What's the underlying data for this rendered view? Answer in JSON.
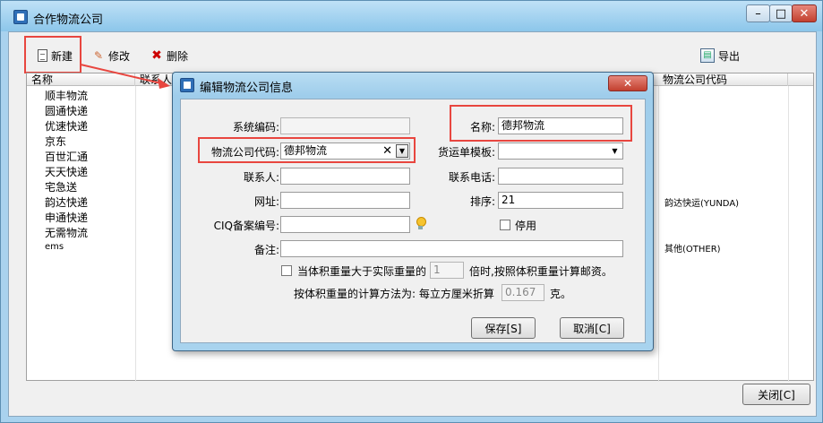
{
  "window": {
    "title": "合作物流公司"
  },
  "toolbar": {
    "new_label": "新建",
    "edit_label": "修改",
    "delete_label": "删除",
    "export_label": "导出"
  },
  "grid": {
    "headers": {
      "name": "名称",
      "contact": "联系人",
      "code": "物流公司代码"
    },
    "rows": [
      {
        "name": "顺丰物流",
        "code": ""
      },
      {
        "name": "圆通快递",
        "code": ""
      },
      {
        "name": "优速快递",
        "code": ""
      },
      {
        "name": "京东",
        "code": ""
      },
      {
        "name": "百世汇通",
        "code": ""
      },
      {
        "name": "天天快递",
        "code": ""
      },
      {
        "name": "宅急送",
        "code": ""
      },
      {
        "name": "韵达快递",
        "code": "韵达快运(YUNDA)"
      },
      {
        "name": "申通快递",
        "code": ""
      },
      {
        "name": "无需物流",
        "code": ""
      },
      {
        "name": "ems",
        "code": "其他(OTHER)"
      }
    ]
  },
  "footer": {
    "close_label": "关闭[C]"
  },
  "dialog": {
    "title": "编辑物流公司信息",
    "labels": {
      "system_code": "系统编码:",
      "name": "名称:",
      "logistics_code": "物流公司代码:",
      "waybill_template": "货运单模板:",
      "contact": "联系人:",
      "phone": "联系电话:",
      "website": "网址:",
      "sort": "排序:",
      "ciq": "CIQ备案编号:",
      "disable": "停用",
      "remark": "备注:",
      "volume_prefix": "当体积重量大于实际重量的",
      "volume_suffix": "倍时,按照体积重量计算邮资。",
      "calc_prefix": "按体积重量的计算方法为: 每立方厘米折算",
      "calc_suffix": "克。"
    },
    "values": {
      "system_code": "",
      "name": "德邦物流",
      "logistics_code": "德邦物流",
      "waybill_template": "",
      "contact": "",
      "phone": "",
      "website": "",
      "sort": "21",
      "ciq": "",
      "remark": "",
      "volume_multiple": "1",
      "per_cm3": "0.167"
    },
    "save_label": "保存[S]",
    "cancel_label": "取消[C]"
  }
}
